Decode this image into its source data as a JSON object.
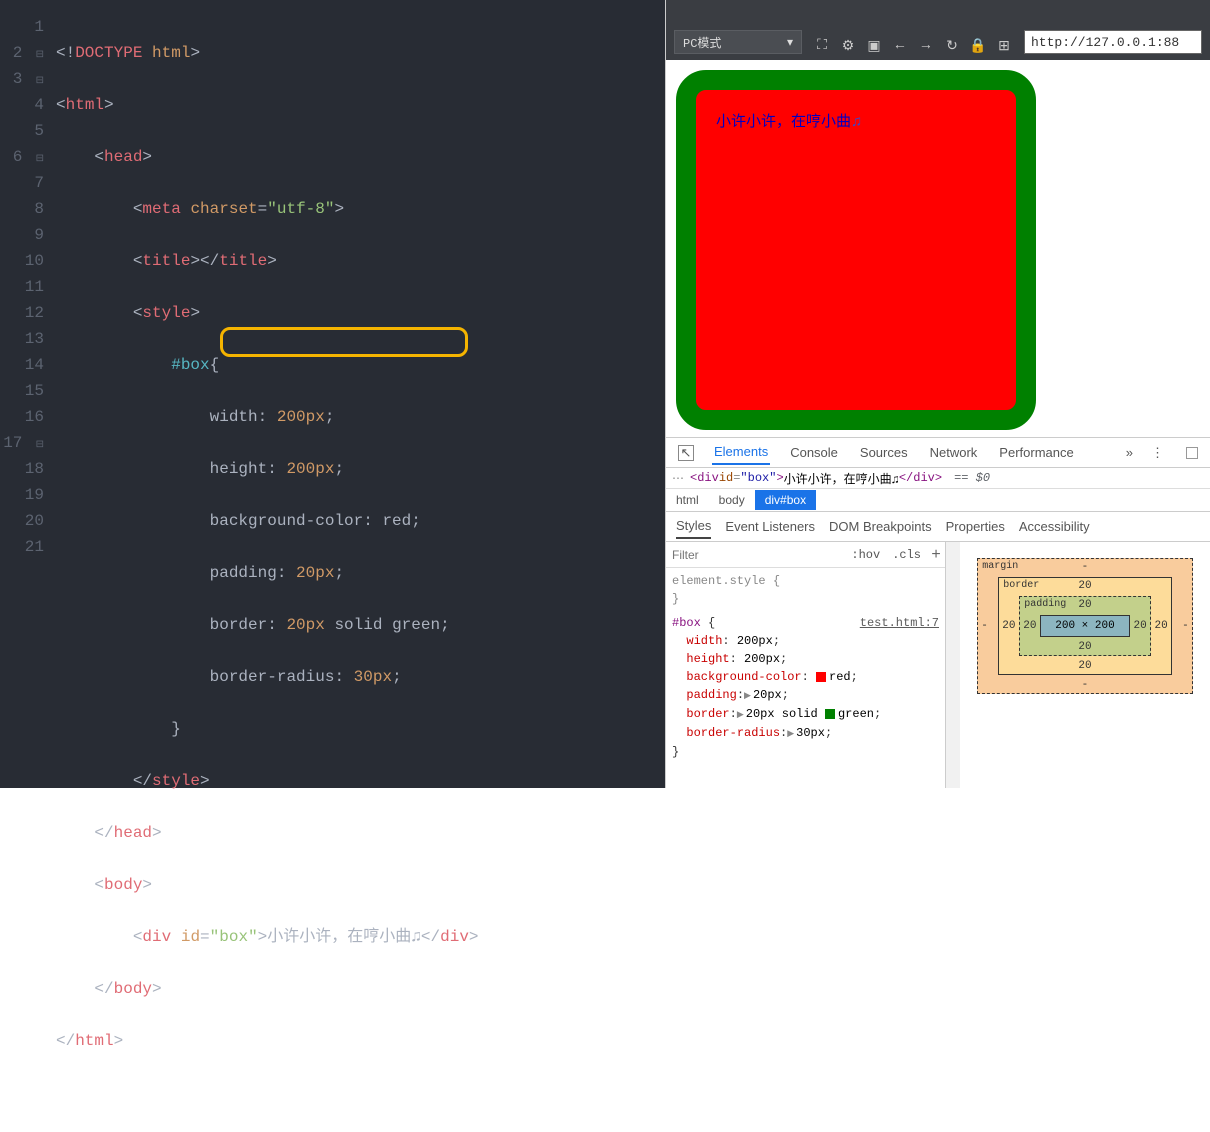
{
  "editor": {
    "lines": [
      1,
      2,
      3,
      4,
      5,
      6,
      7,
      8,
      9,
      10,
      11,
      12,
      13,
      14,
      15,
      16,
      17,
      18,
      19,
      20,
      21
    ]
  },
  "code": {
    "doctype": "<!DOCTYPE html>",
    "html_open": "html",
    "head_open": "head",
    "meta_tag": "meta",
    "meta_attr": "charset",
    "meta_val": "\"utf-8\"",
    "title_tag": "title",
    "style_tag": "style",
    "sel": "#box",
    "p_width_k": "width",
    "p_width_v": "200px",
    "p_height_k": "height",
    "p_height_v": "200px",
    "p_bg_k": "background-color",
    "p_bg_v": "red",
    "p_pad_k": "padding",
    "p_pad_v": "20px",
    "p_border_k": "border",
    "p_border_v1": "20px",
    "p_border_v2": "solid",
    "p_border_v3": "green",
    "p_radius_k": "border-radius",
    "p_radius_v": "30px",
    "head_close": "head",
    "body_tag": "body",
    "div_tag": "div",
    "div_attr": "id",
    "div_val": "\"box\"",
    "div_text": "小许小许，在哼小曲",
    "music_icon": "♫",
    "html_close": "html"
  },
  "browser": {
    "mode": "PC模式",
    "url": "http://127.0.0.1:88"
  },
  "preview": {
    "text": "小许小许，在哼小曲",
    "icon": "♫"
  },
  "devtools": {
    "tabs": [
      "Elements",
      "Console",
      "Sources",
      "Network",
      "Performance"
    ],
    "html_line_pre": "<div id=\"box\">",
    "html_line_txt": "小许小许，在哼小曲♫",
    "html_line_post": "</div>",
    "eq": "== $0",
    "crumbs": [
      "html",
      "body",
      "div#box"
    ],
    "subtabs": [
      "Styles",
      "Event Listeners",
      "DOM Breakpoints",
      "Properties",
      "Accessibility"
    ],
    "filter_placeholder": "Filter",
    "hov": ":hov",
    "cls": ".cls",
    "style_rule_sel": "element.style",
    "box_sel": "#box",
    "box_src": "test.html:7",
    "rules": {
      "width": {
        "k": "width",
        "v": "200px"
      },
      "height": {
        "k": "height",
        "v": "200px"
      },
      "bg": {
        "k": "background-color",
        "v": "red"
      },
      "pad": {
        "k": "padding",
        "v": "20px"
      },
      "border": {
        "k": "border",
        "v": "20px solid ",
        "v2": "green"
      },
      "radius": {
        "k": "border-radius",
        "v": "30px"
      }
    },
    "boxmodel": {
      "margin_label": "margin",
      "border_label": "border",
      "padding_label": "padding",
      "content": "200 × 200",
      "margin": {
        "t": "-",
        "r": "-",
        "b": "-",
        "l": "-"
      },
      "border": {
        "t": "20",
        "r": "20",
        "b": "20",
        "l": "20"
      },
      "padding": {
        "t": "20",
        "r": "20",
        "b": "20",
        "l": "20"
      }
    }
  }
}
